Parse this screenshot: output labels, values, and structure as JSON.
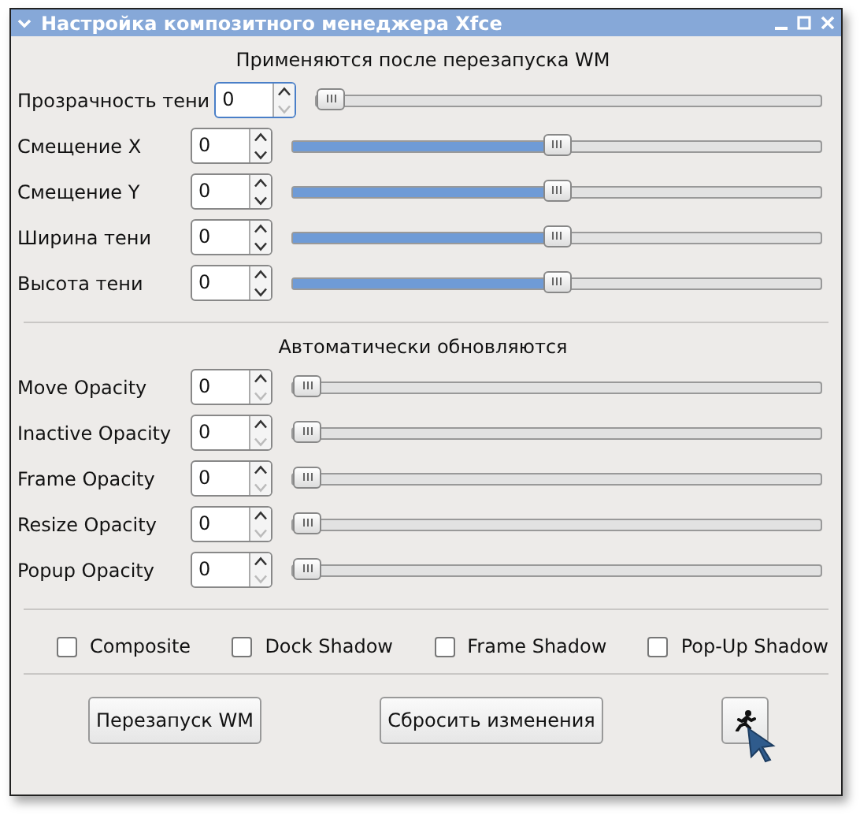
{
  "window": {
    "title": "Настройка композитного менеджера Xfce"
  },
  "sections": [
    {
      "heading": "Применяются после перезапуска WM",
      "rows": [
        {
          "label": "Прозрачность тени",
          "value": "0",
          "level": 0,
          "focused": true,
          "down_disabled": true
        },
        {
          "label": "Смещение X",
          "value": "0",
          "level": 0.5,
          "focused": false,
          "down_disabled": false
        },
        {
          "label": "Смещение Y",
          "value": "0",
          "level": 0.5,
          "focused": false,
          "down_disabled": false
        },
        {
          "label": "Ширина тени",
          "value": "0",
          "level": 0.5,
          "focused": false,
          "down_disabled": false
        },
        {
          "label": "Высота тени",
          "value": "0",
          "level": 0.5,
          "focused": false,
          "down_disabled": false
        }
      ]
    },
    {
      "heading": "Автоматически обновляются",
      "rows": [
        {
          "label": "Move Opacity",
          "value": "0",
          "level": 0,
          "focused": false,
          "down_disabled": true
        },
        {
          "label": "Inactive Opacity",
          "value": "0",
          "level": 0,
          "focused": false,
          "down_disabled": true
        },
        {
          "label": "Frame Opacity",
          "value": "0",
          "level": 0,
          "focused": false,
          "down_disabled": true
        },
        {
          "label": "Resize Opacity",
          "value": "0",
          "level": 0,
          "focused": false,
          "down_disabled": true
        },
        {
          "label": "Popup Opacity",
          "value": "0",
          "level": 0,
          "focused": false,
          "down_disabled": true
        }
      ]
    }
  ],
  "checkboxes": [
    {
      "label": "Composite",
      "checked": false
    },
    {
      "label": "Dock Shadow",
      "checked": false
    },
    {
      "label": "Frame Shadow",
      "checked": false
    },
    {
      "label": "Pop-Up Shadow",
      "checked": false
    }
  ],
  "buttons": [
    {
      "kind": "text",
      "label": "Перезапуск WM"
    },
    {
      "kind": "text",
      "label": "Сбросить изменения"
    },
    {
      "kind": "icon"
    }
  ]
}
